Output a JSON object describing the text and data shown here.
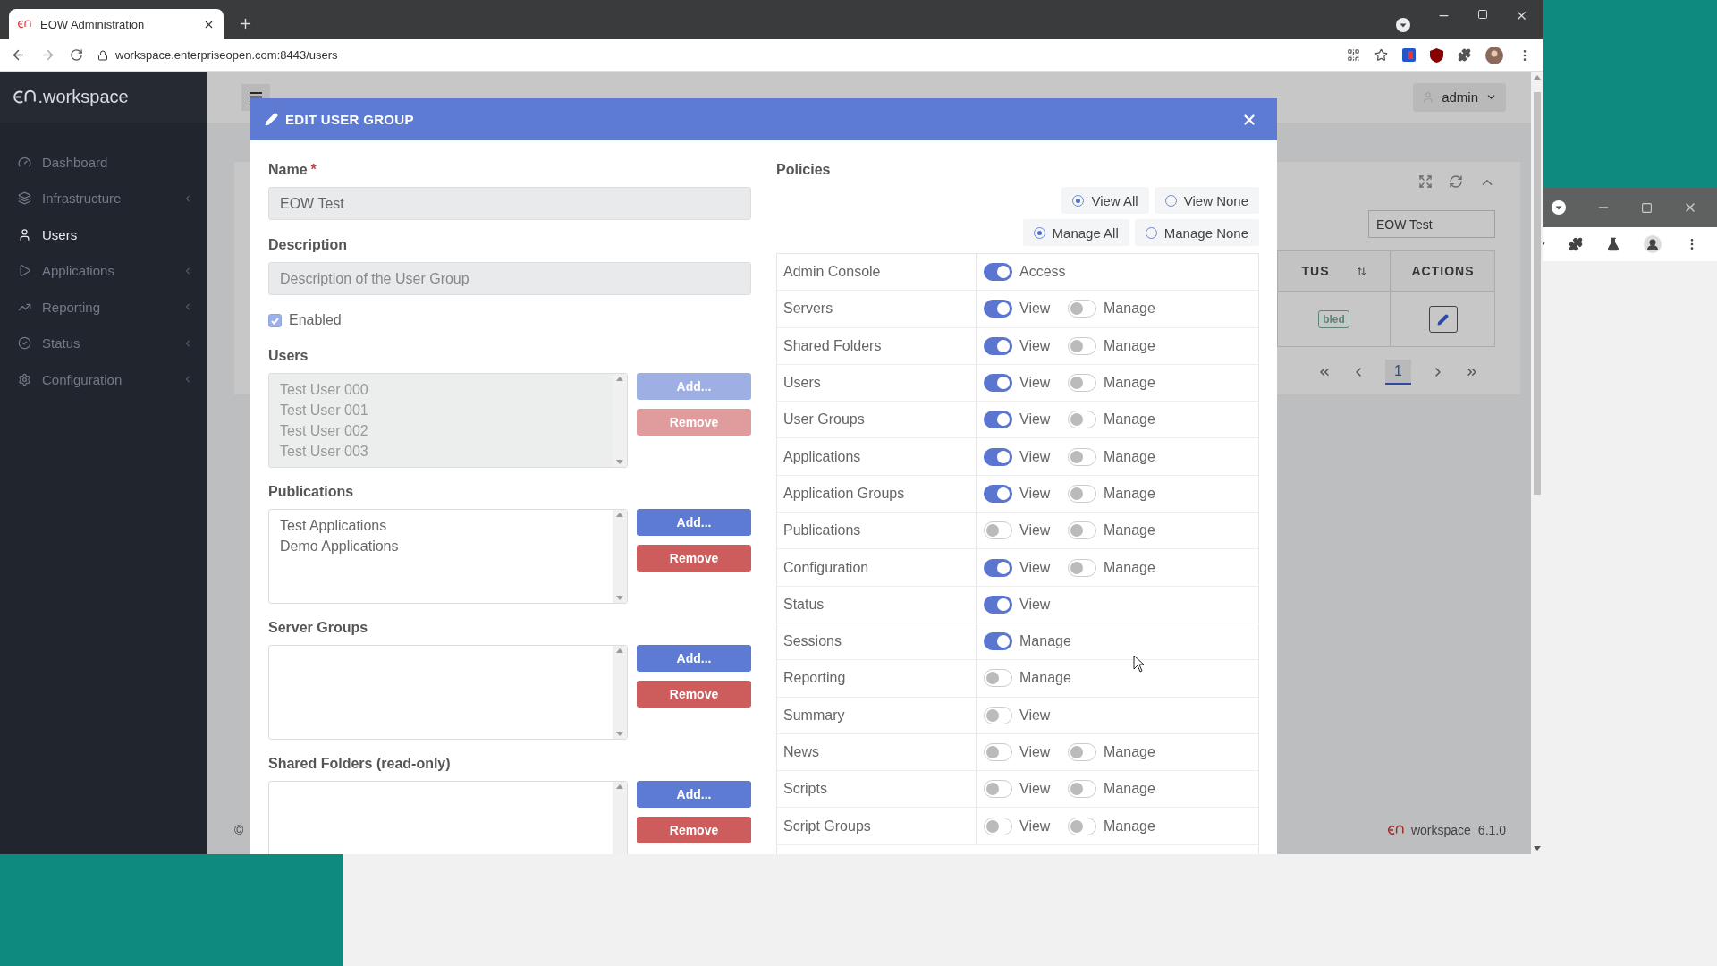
{
  "browser": {
    "tab_title": "EOW Administration",
    "url": "workspace.enterpriseopen.com:8443/users"
  },
  "sidebar": {
    "logo_text": ".workspace",
    "items": [
      {
        "label": "Dashboard",
        "selected": false,
        "expandable": false
      },
      {
        "label": "Infrastructure",
        "selected": false,
        "expandable": true
      },
      {
        "label": "Users",
        "selected": true,
        "expandable": false
      },
      {
        "label": "Applications",
        "selected": false,
        "expandable": true
      },
      {
        "label": "Reporting",
        "selected": false,
        "expandable": true
      },
      {
        "label": "Status",
        "selected": false,
        "expandable": true
      },
      {
        "label": "Configuration",
        "selected": false,
        "expandable": true
      }
    ]
  },
  "topbar": {
    "user": "admin"
  },
  "card": {
    "search": "EOW Test",
    "columns": [
      "TUS",
      "ACTIONS"
    ],
    "status_badge": "bled",
    "pages": [
      {
        "label": "1",
        "selected": true
      }
    ]
  },
  "footer": {
    "copyright": "©",
    "brand": "workspace",
    "version": "6.1.0"
  },
  "modal": {
    "title": "EDIT USER GROUP",
    "name": {
      "label": "Name",
      "required": "*",
      "value": "EOW Test"
    },
    "description": {
      "label": "Description",
      "placeholder": "Description of the User Group"
    },
    "enabled": {
      "label": "Enabled",
      "checked": true
    },
    "lists": [
      {
        "label": "Users",
        "disabled": true,
        "items": [
          "Test User 000",
          "Test User 001",
          "Test User 002",
          "Test User 003"
        ],
        "add": "Add...",
        "remove": "Remove"
      },
      {
        "label": "Publications",
        "disabled": false,
        "items": [
          "Test Applications",
          "Demo Applications"
        ],
        "add": "Add...",
        "remove": "Remove"
      },
      {
        "label": "Server Groups",
        "disabled": false,
        "add": "Add...",
        "remove": "Remove"
      },
      {
        "label": "Shared Folders (read-only)",
        "disabled": false,
        "add": "Add...",
        "remove": "Remove"
      }
    ],
    "policies": {
      "label": "Policies",
      "bulk": [
        {
          "options": [
            {
              "label": "View All",
              "selected": true
            },
            {
              "label": "View None",
              "selected": false
            }
          ]
        },
        {
          "options": [
            {
              "label": "Manage All",
              "selected": true
            },
            {
              "label": "Manage None",
              "selected": false
            }
          ]
        }
      ],
      "rows": [
        {
          "label": "Admin Console",
          "toggles": [
            {
              "label": "Access",
              "on": true
            }
          ]
        },
        {
          "label": "Servers",
          "toggles": [
            {
              "label": "View",
              "on": true
            },
            {
              "label": "Manage",
              "on": false
            }
          ]
        },
        {
          "label": "Shared Folders",
          "toggles": [
            {
              "label": "View",
              "on": true
            },
            {
              "label": "Manage",
              "on": false
            }
          ]
        },
        {
          "label": "Users",
          "toggles": [
            {
              "label": "View",
              "on": true
            },
            {
              "label": "Manage",
              "on": false
            }
          ]
        },
        {
          "label": "User Groups",
          "toggles": [
            {
              "label": "View",
              "on": true
            },
            {
              "label": "Manage",
              "on": false
            }
          ]
        },
        {
          "label": "Applications",
          "toggles": [
            {
              "label": "View",
              "on": true
            },
            {
              "label": "Manage",
              "on": false
            }
          ]
        },
        {
          "label": "Application Groups",
          "toggles": [
            {
              "label": "View",
              "on": true
            },
            {
              "label": "Manage",
              "on": false
            }
          ]
        },
        {
          "label": "Publications",
          "toggles": [
            {
              "label": "View",
              "on": false
            },
            {
              "label": "Manage",
              "on": false
            }
          ]
        },
        {
          "label": "Configuration",
          "toggles": [
            {
              "label": "View",
              "on": true
            },
            {
              "label": "Manage",
              "on": false
            }
          ]
        },
        {
          "label": "Status",
          "toggles": [
            {
              "label": "View",
              "on": true
            }
          ]
        },
        {
          "label": "Sessions",
          "toggles": [
            {
              "label": "Manage",
              "on": true
            }
          ]
        },
        {
          "label": "Reporting",
          "toggles": [
            {
              "label": "Manage",
              "on": false
            }
          ]
        },
        {
          "label": "Summary",
          "toggles": [
            {
              "label": "View",
              "on": false
            }
          ]
        },
        {
          "label": "News",
          "toggles": [
            {
              "label": "View",
              "on": false
            },
            {
              "label": "Manage",
              "on": false
            }
          ]
        },
        {
          "label": "Scripts",
          "toggles": [
            {
              "label": "View",
              "on": false
            },
            {
              "label": "Manage",
              "on": false
            }
          ]
        },
        {
          "label": "Script Groups",
          "toggles": [
            {
              "label": "View",
              "on": false
            },
            {
              "label": "Manage",
              "on": false
            }
          ]
        }
      ]
    }
  }
}
